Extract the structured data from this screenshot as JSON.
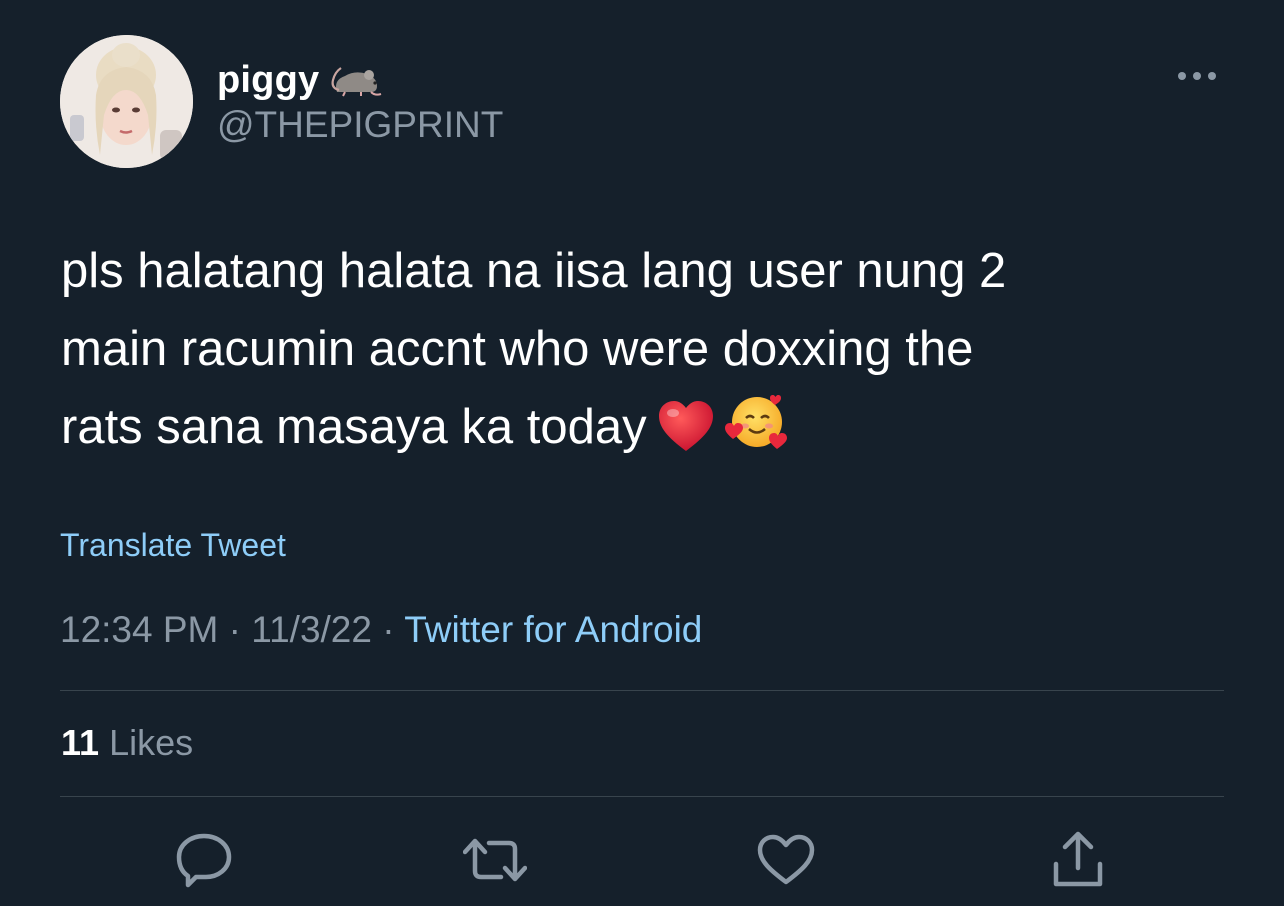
{
  "user": {
    "display_name": "piggy",
    "name_emoji": "rat-icon",
    "handle": "@THEPIGPRINT",
    "avatar": "avatar"
  },
  "tweet": {
    "lines": [
      "pls halatang halata na iisa lang user nung 2",
      "main racumin accnt who were doxxing the",
      "rats sana masaya ka today"
    ],
    "emojis": [
      "red-heart-icon",
      "smiling-face-with-hearts-icon"
    ],
    "translate_label": "Translate Tweet",
    "time": "12:34 PM",
    "date": "11/3/22",
    "separator": "·",
    "source": "Twitter for Android"
  },
  "stats": {
    "likes_count": "11",
    "likes_label": "Likes"
  },
  "actions": [
    "reply-icon",
    "retweet-icon",
    "like-icon",
    "share-icon"
  ],
  "colors": {
    "background": "#15202b",
    "primary_text": "#ffffff",
    "secondary_text": "#8b98a5",
    "link": "#8ecdf8",
    "divider": "#38444d",
    "heart": "#e0245e"
  }
}
